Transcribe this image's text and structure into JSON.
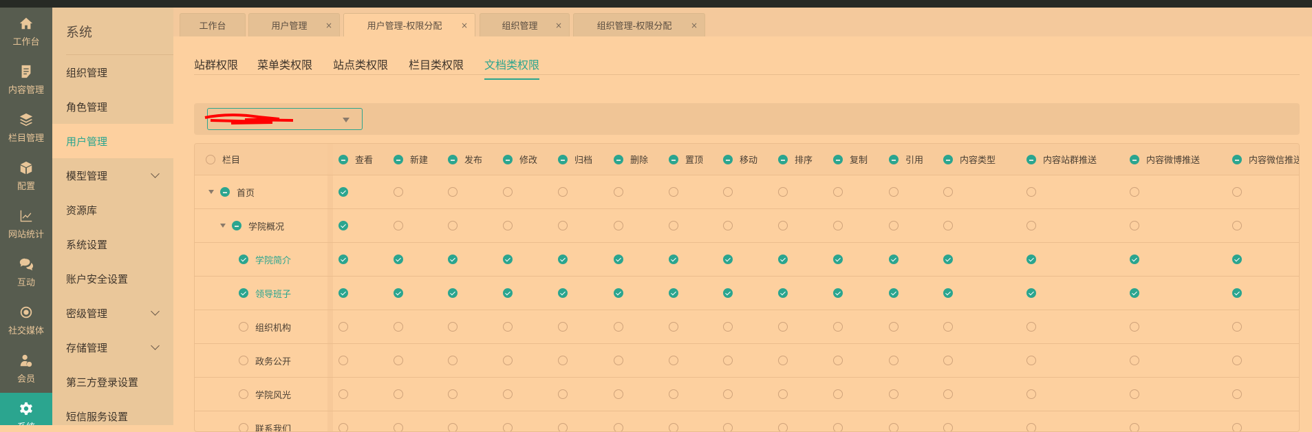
{
  "colors": {
    "accent": "#2ba58f",
    "sidebar": "#575c4f",
    "menu": "#eac79a",
    "content": "#fdd09f"
  },
  "iconbar": [
    {
      "label": "工作台",
      "icon": "home-icon"
    },
    {
      "label": "内容管理",
      "icon": "document-icon"
    },
    {
      "label": "栏目管理",
      "icon": "layers-icon"
    },
    {
      "label": "配置",
      "icon": "box-icon"
    },
    {
      "label": "网站统计",
      "icon": "chart-icon"
    },
    {
      "label": "互动",
      "icon": "chat-icon"
    },
    {
      "label": "社交媒体",
      "icon": "social-icon"
    },
    {
      "label": "会员",
      "icon": "member-icon"
    },
    {
      "label": "系统",
      "icon": "gear-icon",
      "active": true
    }
  ],
  "menu": {
    "title": "系统",
    "items": [
      {
        "label": "组织管理"
      },
      {
        "label": "角色管理"
      },
      {
        "label": "用户管理",
        "active": true
      },
      {
        "label": "模型管理",
        "expand": true
      },
      {
        "label": "资源库"
      },
      {
        "label": "系统设置"
      },
      {
        "label": "账户安全设置"
      },
      {
        "label": "密级管理",
        "expand": true
      },
      {
        "label": "存储管理",
        "expand": true
      },
      {
        "label": "第三方登录设置"
      },
      {
        "label": "短信服务设置"
      }
    ]
  },
  "tabs": [
    {
      "label": "工作台",
      "closable": false
    },
    {
      "label": "用户管理",
      "closable": true
    },
    {
      "label": "用户管理-权限分配",
      "closable": true,
      "active": true
    },
    {
      "label": "组织管理",
      "closable": true
    },
    {
      "label": "组织管理-权限分配",
      "closable": true
    }
  ],
  "close_glyph": "×",
  "subtabs": [
    {
      "label": "站群权限"
    },
    {
      "label": "菜单类权限"
    },
    {
      "label": "站点类权限"
    },
    {
      "label": "栏目类权限"
    },
    {
      "label": "文档类权限",
      "active": true
    }
  ],
  "table": {
    "first_header": "栏目",
    "columns": [
      "查看",
      "新建",
      "发布",
      "修改",
      "归档",
      "删除",
      "置顶",
      "移动",
      "排序",
      "复制",
      "引用",
      "内容类型",
      "内容站群推送",
      "内容微博推送",
      "内容微信推送"
    ],
    "rows": [
      {
        "name": "首页",
        "level": 0,
        "state": "part",
        "expanded": true,
        "checks": [
          1,
          0,
          0,
          0,
          0,
          0,
          0,
          0,
          0,
          0,
          0,
          0,
          0,
          0,
          0
        ]
      },
      {
        "name": "学院概况",
        "level": 1,
        "state": "part",
        "expanded": true,
        "checks": [
          1,
          0,
          0,
          0,
          0,
          0,
          0,
          0,
          0,
          0,
          0,
          0,
          0,
          0,
          0
        ]
      },
      {
        "name": "学院简介",
        "level": 2,
        "state": "on",
        "checks": [
          1,
          1,
          1,
          1,
          1,
          1,
          1,
          1,
          1,
          1,
          1,
          1,
          1,
          1,
          1
        ]
      },
      {
        "name": "领导班子",
        "level": 2,
        "state": "on",
        "checks": [
          1,
          1,
          1,
          1,
          1,
          1,
          1,
          1,
          1,
          1,
          1,
          1,
          1,
          1,
          1
        ]
      },
      {
        "name": "组织机构",
        "level": 2,
        "state": "off",
        "checks": [
          0,
          0,
          0,
          0,
          0,
          0,
          0,
          0,
          0,
          0,
          0,
          0,
          0,
          0,
          0
        ]
      },
      {
        "name": "政务公开",
        "level": 2,
        "state": "off",
        "checks": [
          0,
          0,
          0,
          0,
          0,
          0,
          0,
          0,
          0,
          0,
          0,
          0,
          0,
          0,
          0
        ]
      },
      {
        "name": "学院风光",
        "level": 2,
        "state": "off",
        "checks": [
          0,
          0,
          0,
          0,
          0,
          0,
          0,
          0,
          0,
          0,
          0,
          0,
          0,
          0,
          0
        ]
      },
      {
        "name": "联系我们",
        "level": 2,
        "state": "off",
        "checks": [
          0,
          0,
          0,
          0,
          0,
          0,
          0,
          0,
          0,
          0,
          0,
          0,
          0,
          0,
          0
        ]
      }
    ]
  }
}
